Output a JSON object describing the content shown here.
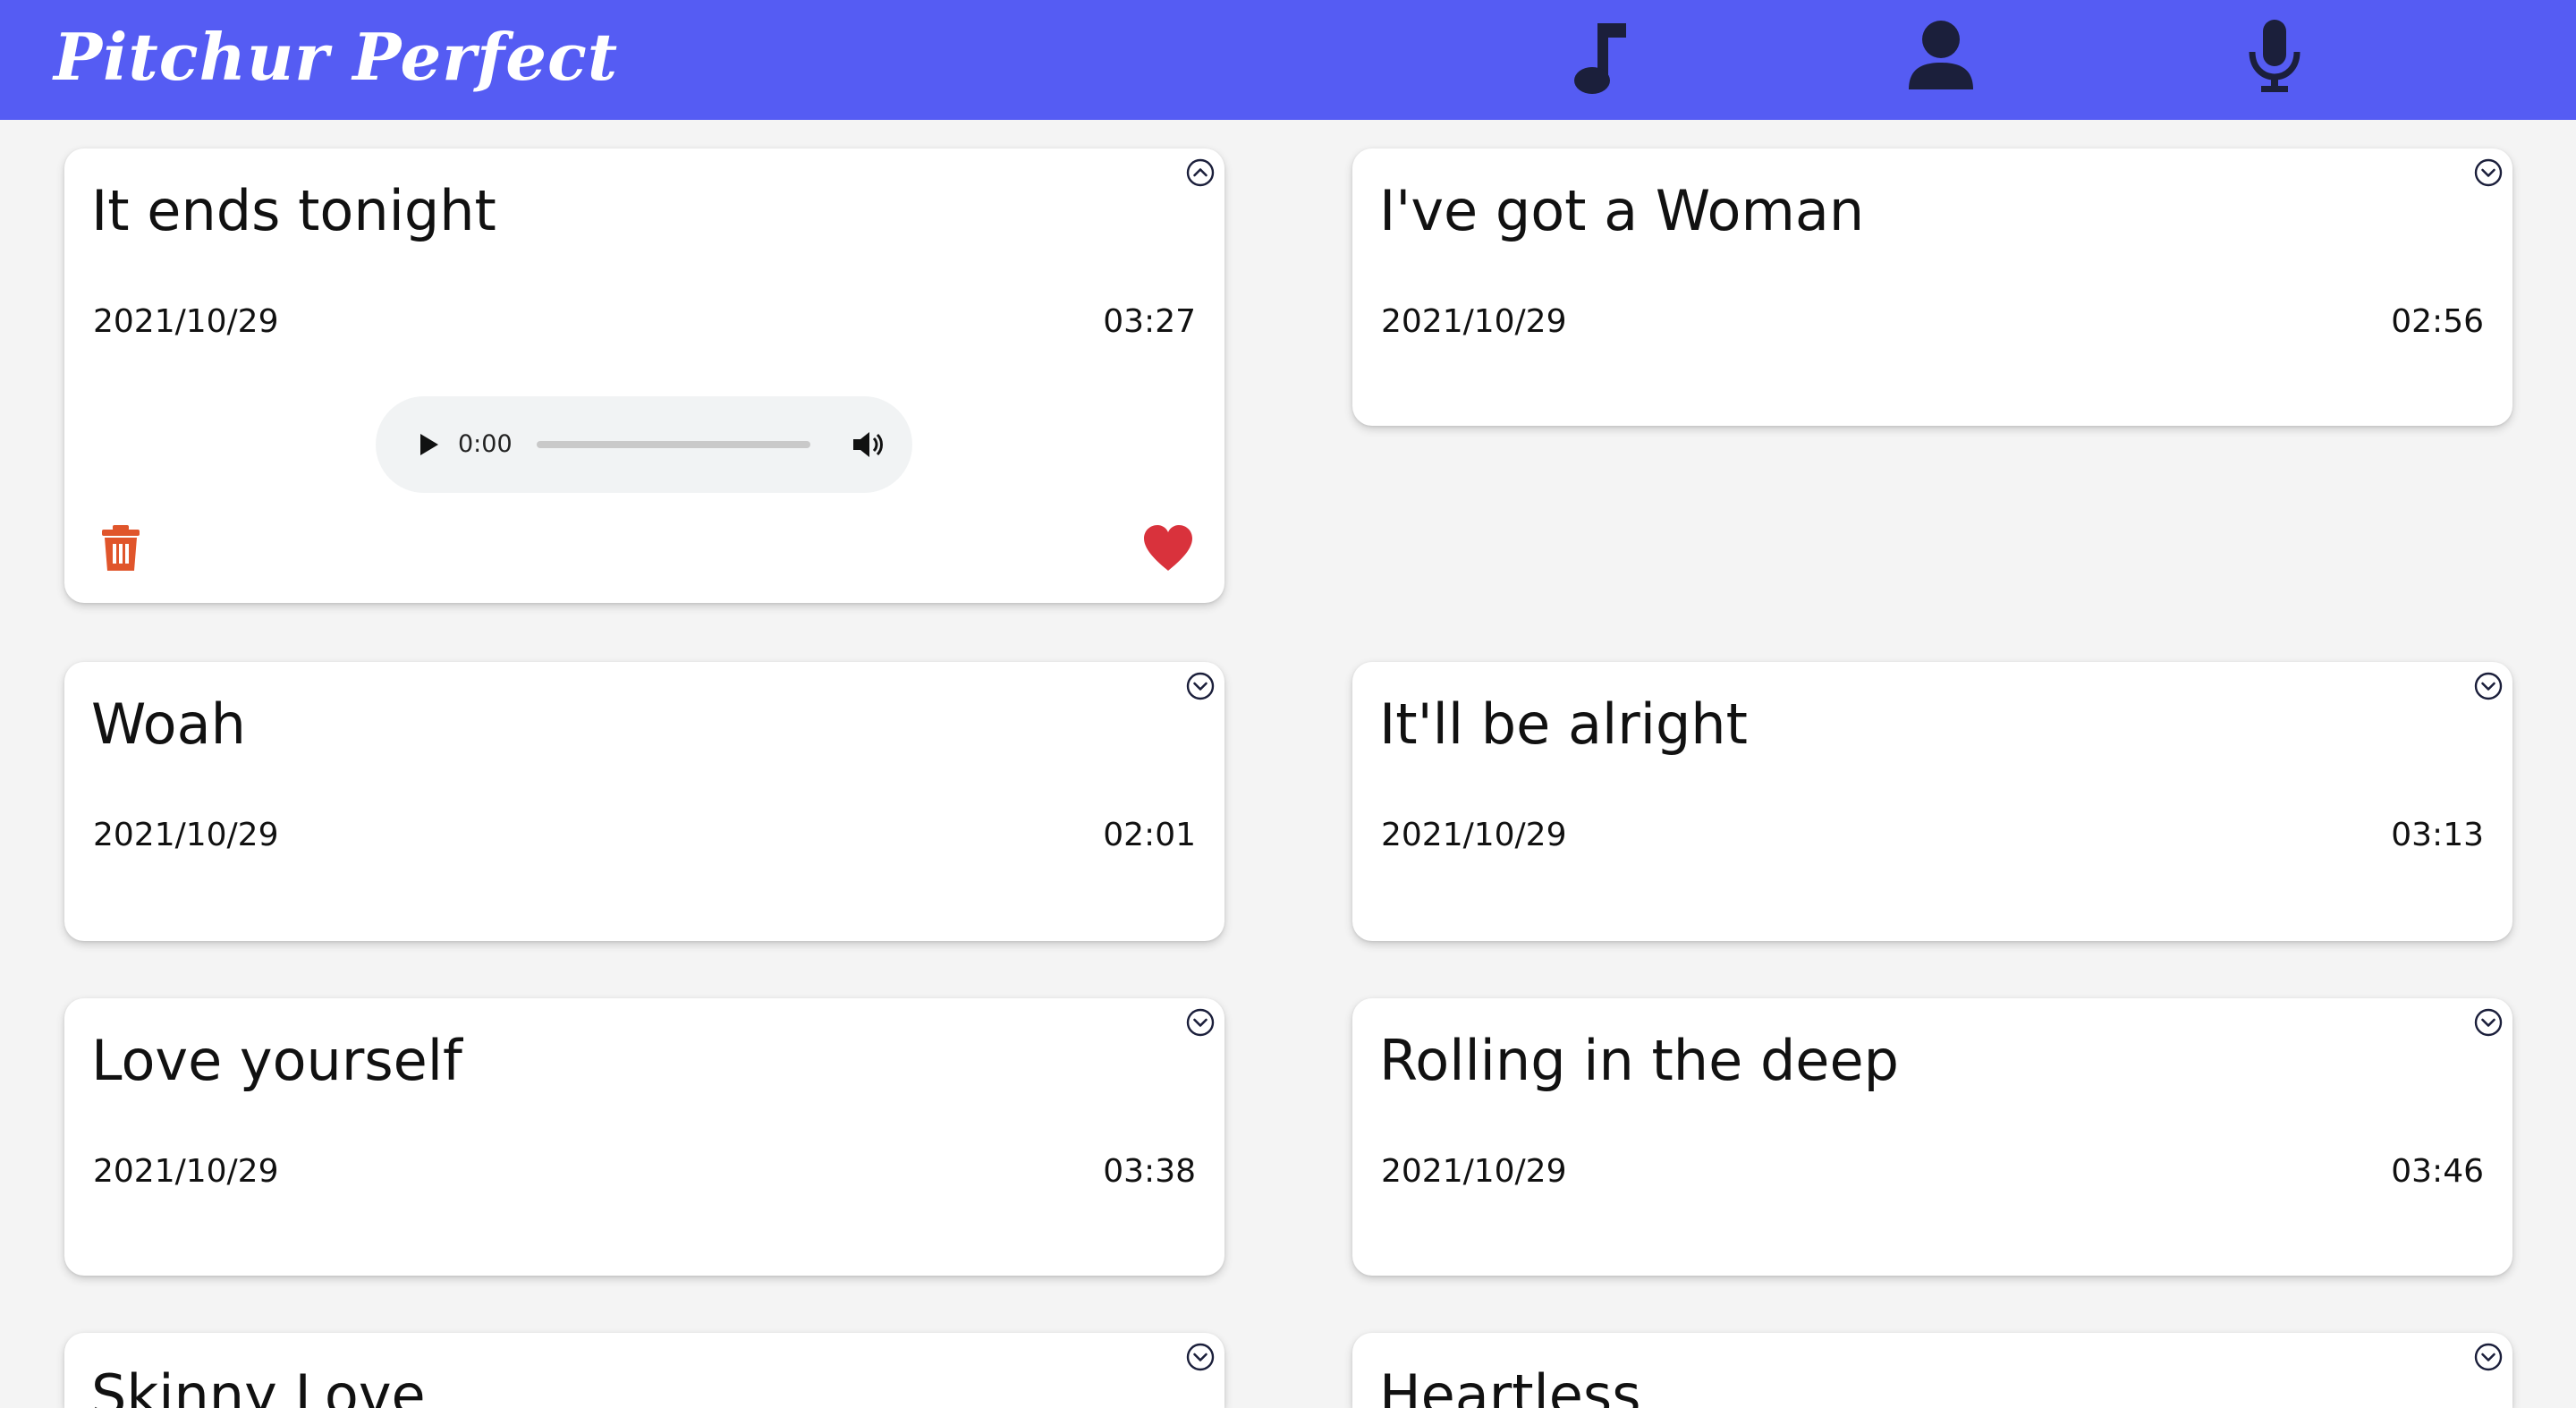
{
  "app": {
    "title": "Pitchur Perfect"
  },
  "nav": [
    {
      "name": "music-icon",
      "color": "#1b1f3b"
    },
    {
      "name": "person-icon",
      "color": "#1b1f3b"
    },
    {
      "name": "microphone-icon",
      "color": "#1b1f3b"
    }
  ],
  "colors": {
    "navbar": "#555cf3",
    "trash": "#e0552b",
    "heart": "#d9323c",
    "toggle": "#1b1f3b"
  },
  "recordings": [
    {
      "title": "It ends tonight",
      "date": "2021/10/29",
      "duration": "03:27",
      "expanded": true,
      "player": {
        "time": "0:00",
        "progress": 0
      },
      "favorite": true
    },
    {
      "title": "I've got a Woman",
      "date": "2021/10/29",
      "duration": "02:56",
      "expanded": false
    },
    {
      "title": "Woah",
      "date": "2021/10/29",
      "duration": "02:01",
      "expanded": false
    },
    {
      "title": "It'll be alright",
      "date": "2021/10/29",
      "duration": "03:13",
      "expanded": false
    },
    {
      "title": "Love yourself",
      "date": "2021/10/29",
      "duration": "03:38",
      "expanded": false
    },
    {
      "title": "Rolling in the deep",
      "date": "2021/10/29",
      "duration": "03:46",
      "expanded": false
    },
    {
      "title": "Skinny Love",
      "expanded": false
    },
    {
      "title": "Heartless",
      "expanded": false
    }
  ]
}
